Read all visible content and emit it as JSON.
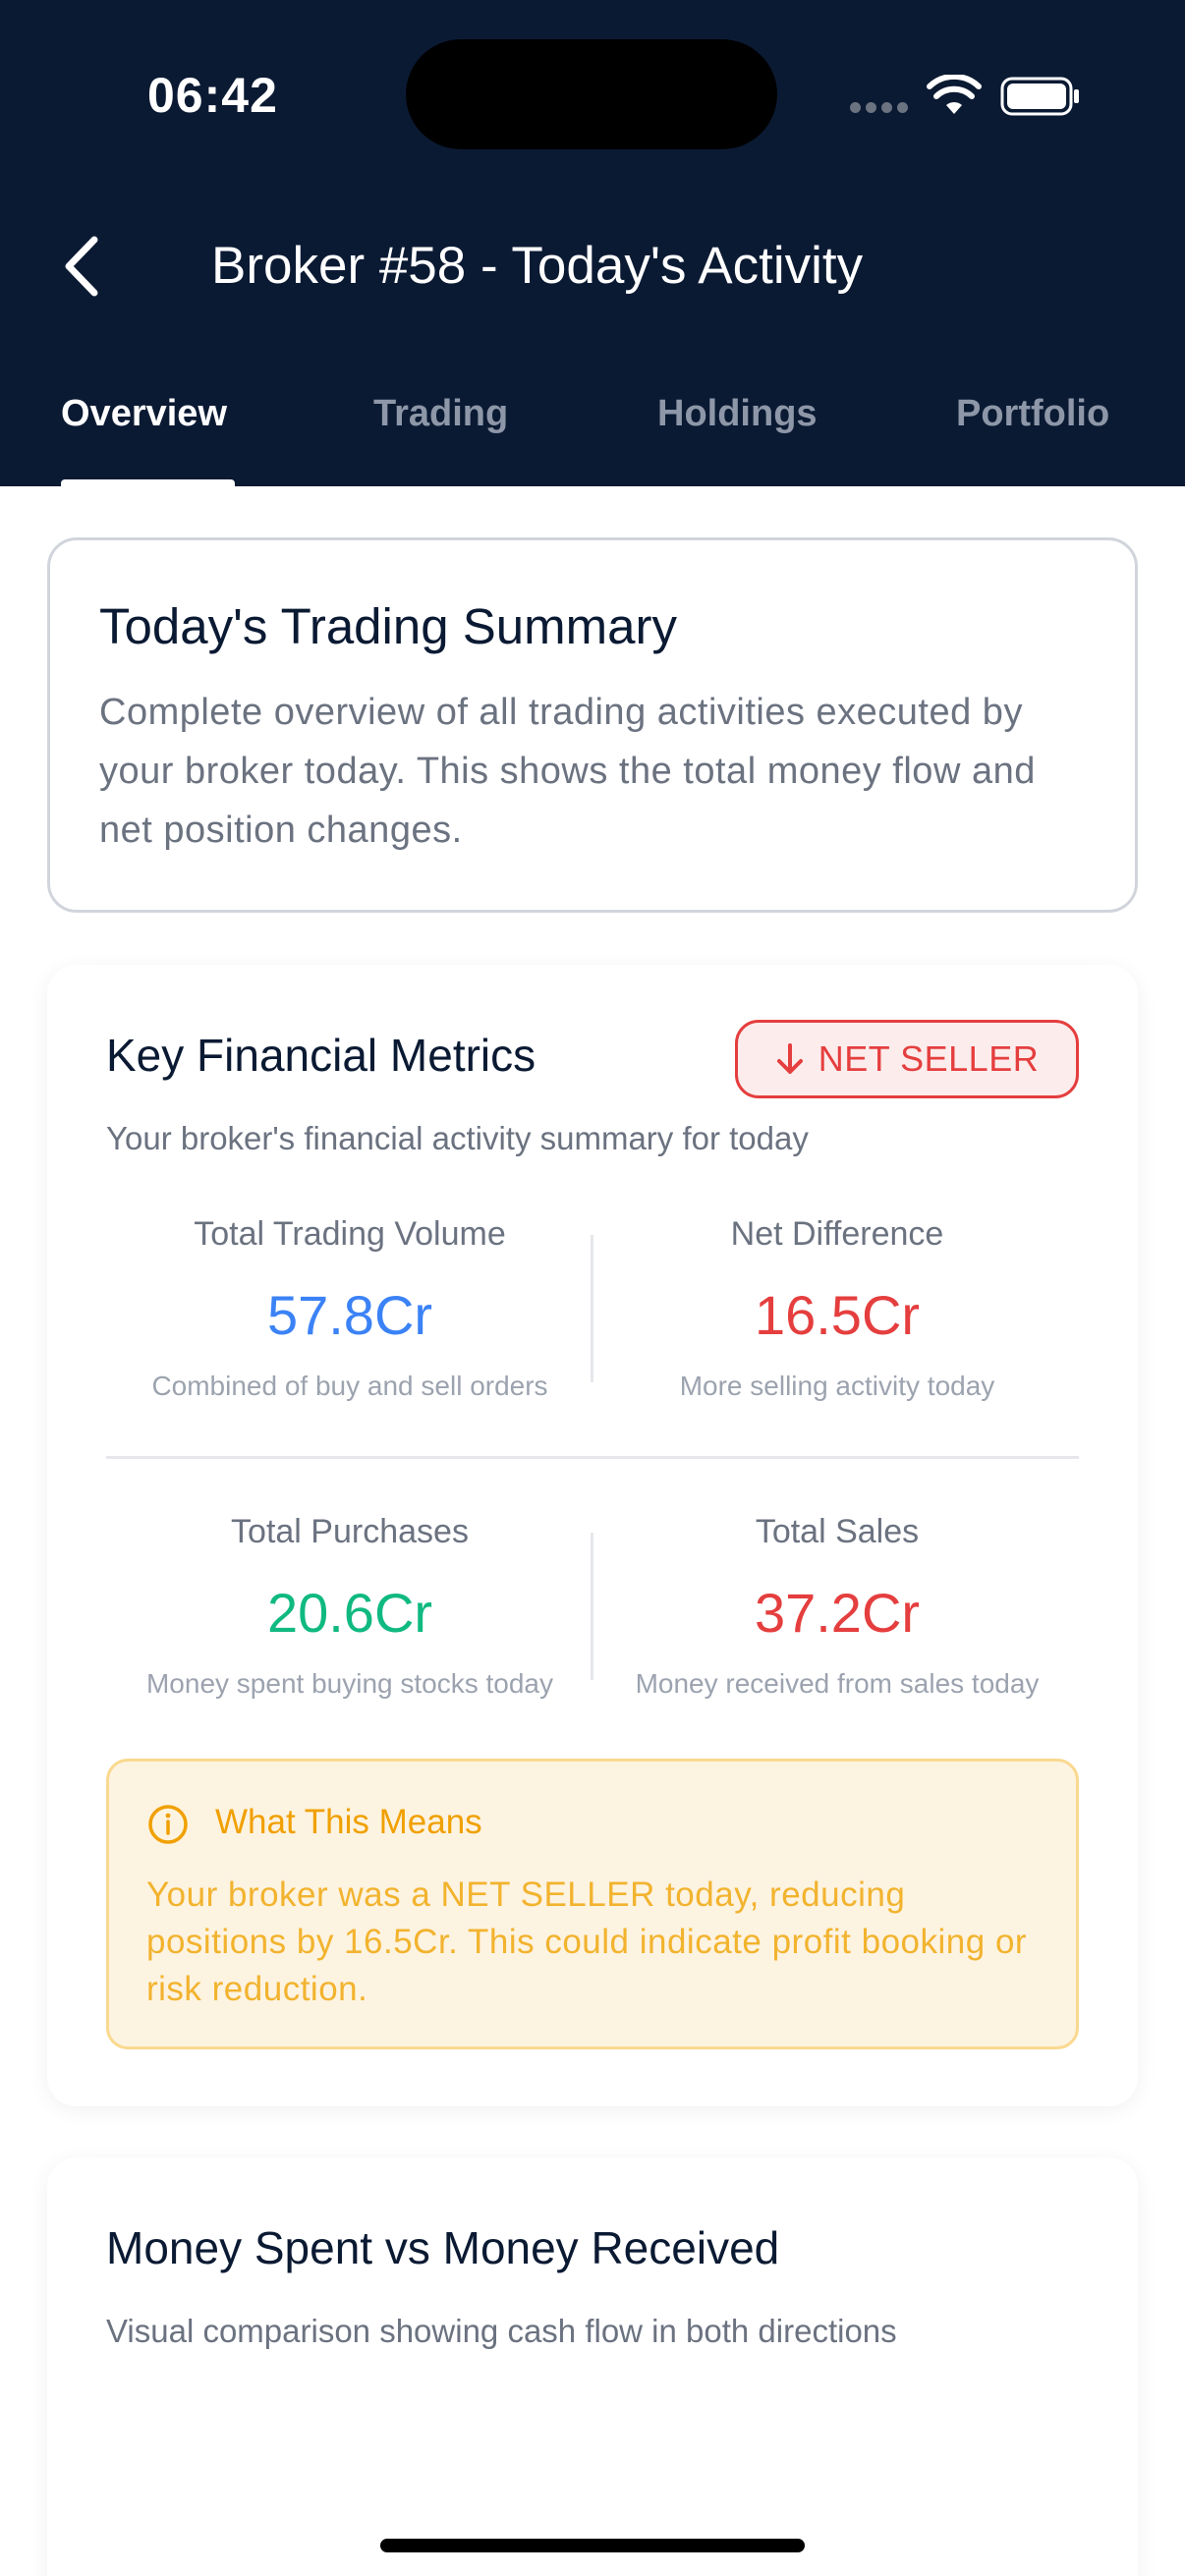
{
  "status_bar": {
    "time": "06:42"
  },
  "header": {
    "title": "Broker #58 - Today's Activity"
  },
  "tabs": [
    {
      "label": "Overview",
      "active": true
    },
    {
      "label": "Trading",
      "active": false
    },
    {
      "label": "Holdings",
      "active": false
    },
    {
      "label": "Portfolio",
      "active": false
    }
  ],
  "summary": {
    "title": "Today's Trading Summary",
    "description": "Complete overview of all trading activities executed by your broker today. This shows the total money flow and net position changes."
  },
  "metrics": {
    "title": "Key Financial Metrics",
    "badge": "NET SELLER",
    "subtitle": "Your broker's financial activity summary for today",
    "items": [
      {
        "label": "Total Trading Volume",
        "value": "57.8Cr",
        "note": "Combined of buy and sell orders",
        "color": "#3b82f6"
      },
      {
        "label": "Net Difference",
        "value": "16.5Cr",
        "note": "More selling activity today",
        "color": "#e53e3e"
      },
      {
        "label": "Total Purchases",
        "value": "20.6Cr",
        "note": "Money spent buying stocks today",
        "color": "#10b981"
      },
      {
        "label": "Total Sales",
        "value": "37.2Cr",
        "note": "Money received from sales today",
        "color": "#e53e3e"
      }
    ],
    "info": {
      "title": "What This Means",
      "body": "Your broker was a NET SELLER today, reducing positions by  16.5Cr. This could indicate profit booking or risk reduction."
    }
  },
  "chart_section": {
    "title": "Money Spent vs Money Received",
    "subtitle": "Visual comparison showing cash flow in both directions"
  },
  "colors": {
    "header_bg": "#0b1a33",
    "accent_red": "#e53e3e",
    "accent_blue": "#3b82f6",
    "accent_green": "#10b981",
    "info_orange": "#f0a000"
  }
}
